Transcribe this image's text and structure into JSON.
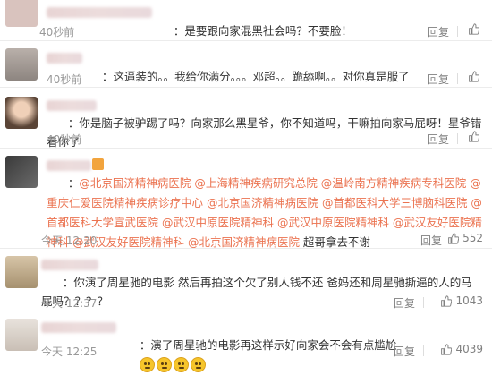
{
  "comments": [
    {
      "colon": "：",
      "text": "是要跟向家混黑社会吗？不要脸！",
      "time": "40秒前",
      "reply": "回复",
      "likes": ""
    },
    {
      "colon": "：",
      "text": "这逼装的。。我给你满分。。。邓超。。跪舔啊。。对你真是服了",
      "time": "40秒前",
      "reply": "回复",
      "likes": ""
    },
    {
      "colon": "：",
      "text": "你是脑子被驴踢了吗？向家那么黑星爷，你不知道吗，干嘛拍向家马屁呀！星爷错看你了",
      "time": "40秒前",
      "reply": "回复",
      "likes": ""
    },
    {
      "colon": "：",
      "mentions": "@北京国济精神病医院 @上海精神疾病研究总院 @温岭南方精神疾病专科医院 @重庆仁爱医院精神疾病诊疗中心 @北京国济精神病医院 @首都医科大学三博脑科医院 @首都医科大学宣武医院 @武汉中原医院精神科 @武汉中原医院精神科 @武汉友好医院精神科 @武汉友好医院精神科 @北京国济精神病医院",
      "tail": " 超哥拿去不谢",
      "time": "今天 12:20",
      "reply": "回复",
      "likes": "552"
    },
    {
      "colon": "：",
      "text": "你演了周星驰的电影 然后再拍这个欠了别人钱不还 爸妈还和周星驰撕逼的人的马屁吗？？？？",
      "time": "今天 12:37",
      "reply": "回复",
      "likes": "1043"
    },
    {
      "colon": "：",
      "text": "演了周星驰的电影再这样示好向家会不会有点尴尬",
      "time": "今天 12:25",
      "reply": "回复",
      "likes": "4039"
    }
  ],
  "colors": {
    "link": "#eb7350",
    "meta": "#999999"
  }
}
